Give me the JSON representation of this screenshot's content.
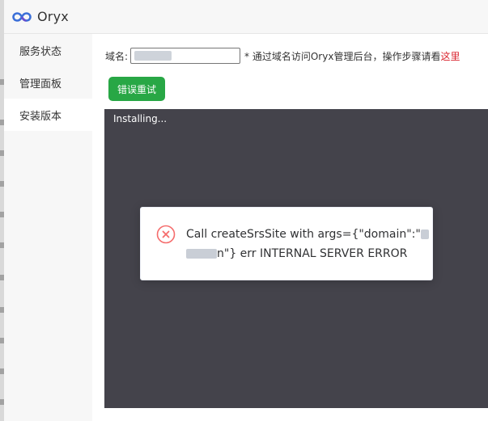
{
  "header": {
    "brand": "Oryx",
    "logo_icon": "infinity-logo-icon"
  },
  "sidebar": {
    "items": [
      {
        "label": "服务状态"
      },
      {
        "label": "管理面板"
      },
      {
        "label": "安装版本",
        "active": true
      }
    ]
  },
  "main": {
    "domain_label": "域名:",
    "domain_input_value": "",
    "hint_text": "* 通过域名访问Oryx管理后台，操作步骤请看",
    "hint_link": "这里",
    "retry_button": "错误重试",
    "terminal_text": "Installing..."
  },
  "toast": {
    "icon": "error-circle-x-icon",
    "line1": "Call createSrsSite with args={\"domain\":\"",
    "line2_end": "n\"} err INTERNAL SERVER ERROR"
  },
  "colors": {
    "accent_green": "#28a745",
    "link_red": "#d9232d",
    "terminal_bg": "#44434b",
    "error_red": "#f56c6c"
  }
}
